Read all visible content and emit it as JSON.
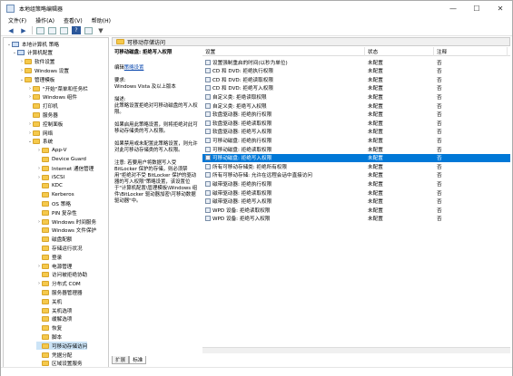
{
  "window": {
    "title": "本地组策略编辑器",
    "controls": [
      "—",
      "☐",
      "✕"
    ]
  },
  "menu": [
    "文件(F)",
    "操作(A)",
    "查看(V)",
    "帮助(H)"
  ],
  "toolbar_icons": [
    "back-arrow-icon",
    "forward-arrow-icon",
    "up-folder-icon",
    "show-tree-icon",
    "export-list-icon",
    "help-icon",
    "properties-icon",
    "filter-icon"
  ],
  "tree": {
    "items": [
      {
        "label": "本地计算机 策略",
        "level": 0,
        "expanded": true
      },
      {
        "label": "计算机配置",
        "level": 1,
        "expanded": true
      },
      {
        "label": "软件设置",
        "level": 2,
        "expanded": false
      },
      {
        "label": "Windows 设置",
        "level": 2,
        "expanded": false
      },
      {
        "label": "管理模板",
        "level": 2,
        "expanded": true
      },
      {
        "label": "\"开始\"菜单和任务栏",
        "level": 3,
        "expanded": false
      },
      {
        "label": "Windows 组件",
        "level": 3,
        "expanded": false
      },
      {
        "label": "打印机",
        "level": 3,
        "expanded": null
      },
      {
        "label": "服务器",
        "level": 3,
        "expanded": null
      },
      {
        "label": "控制面板",
        "level": 3,
        "expanded": false
      },
      {
        "label": "网络",
        "level": 3,
        "expanded": false
      },
      {
        "label": "系统",
        "level": 3,
        "expanded": true
      },
      {
        "label": "App-V",
        "level": 4,
        "expanded": false
      },
      {
        "label": "Device Guard",
        "level": 4,
        "expanded": null
      },
      {
        "label": "Internet 通信管理",
        "level": 4,
        "expanded": false
      },
      {
        "label": "iSCSI",
        "level": 4,
        "expanded": false
      },
      {
        "label": "KDC",
        "level": 4,
        "expanded": null
      },
      {
        "label": "Kerberos",
        "level": 4,
        "expanded": null
      },
      {
        "label": "OS 策略",
        "level": 4,
        "expanded": null
      },
      {
        "label": "PIN 复杂性",
        "level": 4,
        "expanded": null
      },
      {
        "label": "Windows 时间服务",
        "level": 4,
        "expanded": false
      },
      {
        "label": "Windows 文件保护",
        "level": 4,
        "expanded": null
      },
      {
        "label": "磁盘配额",
        "level": 4,
        "expanded": null
      },
      {
        "label": "存储运行状况",
        "level": 4,
        "expanded": null
      },
      {
        "label": "登录",
        "level": 4,
        "expanded": null
      },
      {
        "label": "电源管理",
        "level": 4,
        "expanded": false
      },
      {
        "label": "访问被拒绝协助",
        "level": 4,
        "expanded": null
      },
      {
        "label": "分布式 COM",
        "level": 4,
        "expanded": false
      },
      {
        "label": "服务器管理器",
        "level": 4,
        "expanded": null
      },
      {
        "label": "关机",
        "level": 4,
        "expanded": null
      },
      {
        "label": "关机选项",
        "level": 4,
        "expanded": null
      },
      {
        "label": "缓解选项",
        "level": 4,
        "expanded": null
      },
      {
        "label": "恢复",
        "level": 4,
        "expanded": null
      },
      {
        "label": "脚本",
        "level": 4,
        "expanded": null
      },
      {
        "label": "可移动存储访问",
        "level": 4,
        "expanded": null,
        "selected": true
      },
      {
        "label": "凭据分配",
        "level": 4,
        "expanded": null
      },
      {
        "label": "区域设置服务",
        "level": 4,
        "expanded": null
      }
    ]
  },
  "header": {
    "folder_label": "可移动存储访问"
  },
  "description": {
    "title": "可移动磁盘: 拒绝写入权限",
    "edit_prefix": "编辑",
    "edit_link": "策略设置",
    "req_label": "要求:",
    "req_value": "Windows Vista 及以上版本",
    "desc_label": "描述:",
    "desc_text": "此策略设置拒绝对可移动磁盘的写入权限。",
    "enable_text": "如果启用此策略设置，则将拒绝对此可移动存储类的写入权限。",
    "disable_text": "如果禁用或未配置此策略设置，则允许对此可移动存储类的写入权限。",
    "note_text": "注意: 若要用户将数据写入受 BitLocker 保护的存储，则必须禁用\"拒绝对不受 BitLocker 保护的驱动器的写入权限\"策略设置，该设置位于\"计算机配置\\管理模板\\Windows 组件\\BitLocker 驱动器加密\\可移动数据驱动器\"中。"
  },
  "list": {
    "columns": [
      "设置",
      "状态",
      "注释"
    ],
    "rows": [
      {
        "name": "设置强制重启的时间(以秒为单位)",
        "state": "未配置",
        "comment": "否"
      },
      {
        "name": "CD 和 DVD: 拒绝执行权限",
        "state": "未配置",
        "comment": "否"
      },
      {
        "name": "CD 和 DVD: 拒绝读取权限",
        "state": "未配置",
        "comment": "否"
      },
      {
        "name": "CD 和 DVD: 拒绝写入权限",
        "state": "未配置",
        "comment": "否"
      },
      {
        "name": "自定义类: 拒绝读取权限",
        "state": "未配置",
        "comment": "否"
      },
      {
        "name": "自定义类: 拒绝写入权限",
        "state": "未配置",
        "comment": "否"
      },
      {
        "name": "软盘驱动器: 拒绝执行权限",
        "state": "未配置",
        "comment": "否"
      },
      {
        "name": "软盘驱动器: 拒绝读取权限",
        "state": "未配置",
        "comment": "否"
      },
      {
        "name": "软盘驱动器: 拒绝写入权限",
        "state": "未配置",
        "comment": "否"
      },
      {
        "name": "可移动磁盘: 拒绝执行权限",
        "state": "未配置",
        "comment": "否"
      },
      {
        "name": "可移动磁盘: 拒绝读取权限",
        "state": "未配置",
        "comment": "否"
      },
      {
        "name": "可移动磁盘: 拒绝写入权限",
        "state": "未配置",
        "comment": "否",
        "selected": true
      },
      {
        "name": "所有可移动存储类: 拒绝所有权限",
        "state": "未配置",
        "comment": "否"
      },
      {
        "name": "所有可移动存储: 允许在远程会话中直接访问",
        "state": "未配置",
        "comment": "否"
      },
      {
        "name": "磁带驱动器: 拒绝执行权限",
        "state": "未配置",
        "comment": "否"
      },
      {
        "name": "磁带驱动器: 拒绝读取权限",
        "state": "未配置",
        "comment": "否"
      },
      {
        "name": "磁带驱动器: 拒绝写入权限",
        "state": "未配置",
        "comment": "否"
      },
      {
        "name": "WPD 设备: 拒绝读取权限",
        "state": "未配置",
        "comment": "否"
      },
      {
        "name": "WPD 设备: 拒绝写入权限",
        "state": "未配置",
        "comment": "否"
      }
    ]
  },
  "tabs": [
    "扩展",
    "标准"
  ],
  "colors": {
    "selection": "#0078d7",
    "tree_selection": "#cce4f7",
    "folder": "#f5c94c"
  }
}
